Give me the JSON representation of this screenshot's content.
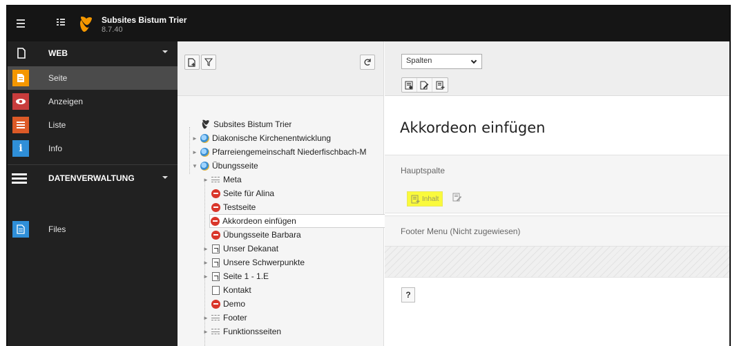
{
  "topbar": {
    "site_title": "Subsites Bistum Trier",
    "site_version": "8.7.40",
    "icons": [
      "hamburger-icon",
      "page-tree-toggle-icon",
      "typo3-logo"
    ]
  },
  "modules": {
    "groups": [
      {
        "label": "WEB",
        "icon": "document-icon"
      },
      {
        "label": "DATENVERWALTUNG",
        "icon": "menu-icon"
      }
    ],
    "web_items": [
      {
        "label": "Seite",
        "icon": "page-icon",
        "color": "#f49700",
        "active": true
      },
      {
        "label": "Anzeigen",
        "icon": "eye-icon",
        "color": "#c83c3c",
        "active": false
      },
      {
        "label": "Liste",
        "icon": "list-icon",
        "color": "#dd5a27",
        "active": false
      },
      {
        "label": "Info",
        "icon": "info-icon",
        "color": "#2f8fd8",
        "active": false
      }
    ],
    "data_items": [
      {
        "label": "Files",
        "icon": "files-icon",
        "color": "#2f8fd8",
        "active": false
      }
    ]
  },
  "tree": {
    "root": "Subsites Bistum Trier",
    "nodes": [
      {
        "label": "Diakonische Kirchenentwicklung",
        "icon": "globe-icon"
      },
      {
        "label": "Pfarreiengemeinschaft Niederfischbach-M",
        "icon": "globe-icon"
      },
      {
        "label": "Übungsseite",
        "icon": "globe-icon"
      },
      {
        "label": "Meta",
        "icon": "divider-icon"
      },
      {
        "label": "Seite für Alina",
        "icon": "page-hidden-icon"
      },
      {
        "label": "Testseite",
        "icon": "page-hidden-icon"
      },
      {
        "label": "Akkordeon einfügen",
        "icon": "page-hidden-icon"
      },
      {
        "label": "Übungsseite Barbara",
        "icon": "page-hidden-icon"
      },
      {
        "label": "Unser Dekanat",
        "icon": "shortcut-icon"
      },
      {
        "label": "Unsere Schwerpunkte",
        "icon": "shortcut-icon"
      },
      {
        "label": "Seite 1 - 1.E",
        "icon": "shortcut-icon"
      },
      {
        "label": "Kontakt",
        "icon": "page-icon"
      },
      {
        "label": "Demo",
        "icon": "page-hidden-icon"
      },
      {
        "label": "Footer",
        "icon": "divider-icon"
      },
      {
        "label": "Funktionsseiten",
        "icon": "divider-icon"
      }
    ]
  },
  "main": {
    "view_select": "Spalten",
    "page_title": "Akkordeon einfügen",
    "columns": [
      {
        "label": "Hauptspalte"
      },
      {
        "label": "Footer Menu (Nicht zugewiesen)"
      }
    ],
    "add_content_label": "Inhalt",
    "help_label": "?"
  }
}
